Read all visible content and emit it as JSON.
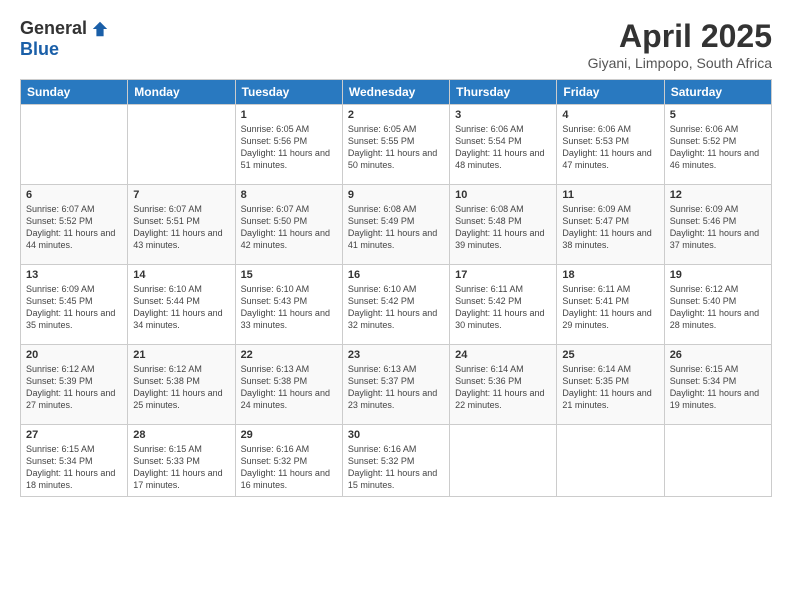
{
  "header": {
    "logo_general": "General",
    "logo_blue": "Blue",
    "title": "April 2025",
    "subtitle": "Giyani, Limpopo, South Africa"
  },
  "calendar": {
    "days_of_week": [
      "Sunday",
      "Monday",
      "Tuesday",
      "Wednesday",
      "Thursday",
      "Friday",
      "Saturday"
    ],
    "weeks": [
      [
        {
          "day": "",
          "info": ""
        },
        {
          "day": "",
          "info": ""
        },
        {
          "day": "1",
          "info": "Sunrise: 6:05 AM\nSunset: 5:56 PM\nDaylight: 11 hours and 51 minutes."
        },
        {
          "day": "2",
          "info": "Sunrise: 6:05 AM\nSunset: 5:55 PM\nDaylight: 11 hours and 50 minutes."
        },
        {
          "day": "3",
          "info": "Sunrise: 6:06 AM\nSunset: 5:54 PM\nDaylight: 11 hours and 48 minutes."
        },
        {
          "day": "4",
          "info": "Sunrise: 6:06 AM\nSunset: 5:53 PM\nDaylight: 11 hours and 47 minutes."
        },
        {
          "day": "5",
          "info": "Sunrise: 6:06 AM\nSunset: 5:52 PM\nDaylight: 11 hours and 46 minutes."
        }
      ],
      [
        {
          "day": "6",
          "info": "Sunrise: 6:07 AM\nSunset: 5:52 PM\nDaylight: 11 hours and 44 minutes."
        },
        {
          "day": "7",
          "info": "Sunrise: 6:07 AM\nSunset: 5:51 PM\nDaylight: 11 hours and 43 minutes."
        },
        {
          "day": "8",
          "info": "Sunrise: 6:07 AM\nSunset: 5:50 PM\nDaylight: 11 hours and 42 minutes."
        },
        {
          "day": "9",
          "info": "Sunrise: 6:08 AM\nSunset: 5:49 PM\nDaylight: 11 hours and 41 minutes."
        },
        {
          "day": "10",
          "info": "Sunrise: 6:08 AM\nSunset: 5:48 PM\nDaylight: 11 hours and 39 minutes."
        },
        {
          "day": "11",
          "info": "Sunrise: 6:09 AM\nSunset: 5:47 PM\nDaylight: 11 hours and 38 minutes."
        },
        {
          "day": "12",
          "info": "Sunrise: 6:09 AM\nSunset: 5:46 PM\nDaylight: 11 hours and 37 minutes."
        }
      ],
      [
        {
          "day": "13",
          "info": "Sunrise: 6:09 AM\nSunset: 5:45 PM\nDaylight: 11 hours and 35 minutes."
        },
        {
          "day": "14",
          "info": "Sunrise: 6:10 AM\nSunset: 5:44 PM\nDaylight: 11 hours and 34 minutes."
        },
        {
          "day": "15",
          "info": "Sunrise: 6:10 AM\nSunset: 5:43 PM\nDaylight: 11 hours and 33 minutes."
        },
        {
          "day": "16",
          "info": "Sunrise: 6:10 AM\nSunset: 5:42 PM\nDaylight: 11 hours and 32 minutes."
        },
        {
          "day": "17",
          "info": "Sunrise: 6:11 AM\nSunset: 5:42 PM\nDaylight: 11 hours and 30 minutes."
        },
        {
          "day": "18",
          "info": "Sunrise: 6:11 AM\nSunset: 5:41 PM\nDaylight: 11 hours and 29 minutes."
        },
        {
          "day": "19",
          "info": "Sunrise: 6:12 AM\nSunset: 5:40 PM\nDaylight: 11 hours and 28 minutes."
        }
      ],
      [
        {
          "day": "20",
          "info": "Sunrise: 6:12 AM\nSunset: 5:39 PM\nDaylight: 11 hours and 27 minutes."
        },
        {
          "day": "21",
          "info": "Sunrise: 6:12 AM\nSunset: 5:38 PM\nDaylight: 11 hours and 25 minutes."
        },
        {
          "day": "22",
          "info": "Sunrise: 6:13 AM\nSunset: 5:38 PM\nDaylight: 11 hours and 24 minutes."
        },
        {
          "day": "23",
          "info": "Sunrise: 6:13 AM\nSunset: 5:37 PM\nDaylight: 11 hours and 23 minutes."
        },
        {
          "day": "24",
          "info": "Sunrise: 6:14 AM\nSunset: 5:36 PM\nDaylight: 11 hours and 22 minutes."
        },
        {
          "day": "25",
          "info": "Sunrise: 6:14 AM\nSunset: 5:35 PM\nDaylight: 11 hours and 21 minutes."
        },
        {
          "day": "26",
          "info": "Sunrise: 6:15 AM\nSunset: 5:34 PM\nDaylight: 11 hours and 19 minutes."
        }
      ],
      [
        {
          "day": "27",
          "info": "Sunrise: 6:15 AM\nSunset: 5:34 PM\nDaylight: 11 hours and 18 minutes."
        },
        {
          "day": "28",
          "info": "Sunrise: 6:15 AM\nSunset: 5:33 PM\nDaylight: 11 hours and 17 minutes."
        },
        {
          "day": "29",
          "info": "Sunrise: 6:16 AM\nSunset: 5:32 PM\nDaylight: 11 hours and 16 minutes."
        },
        {
          "day": "30",
          "info": "Sunrise: 6:16 AM\nSunset: 5:32 PM\nDaylight: 11 hours and 15 minutes."
        },
        {
          "day": "",
          "info": ""
        },
        {
          "day": "",
          "info": ""
        },
        {
          "day": "",
          "info": ""
        }
      ]
    ]
  }
}
